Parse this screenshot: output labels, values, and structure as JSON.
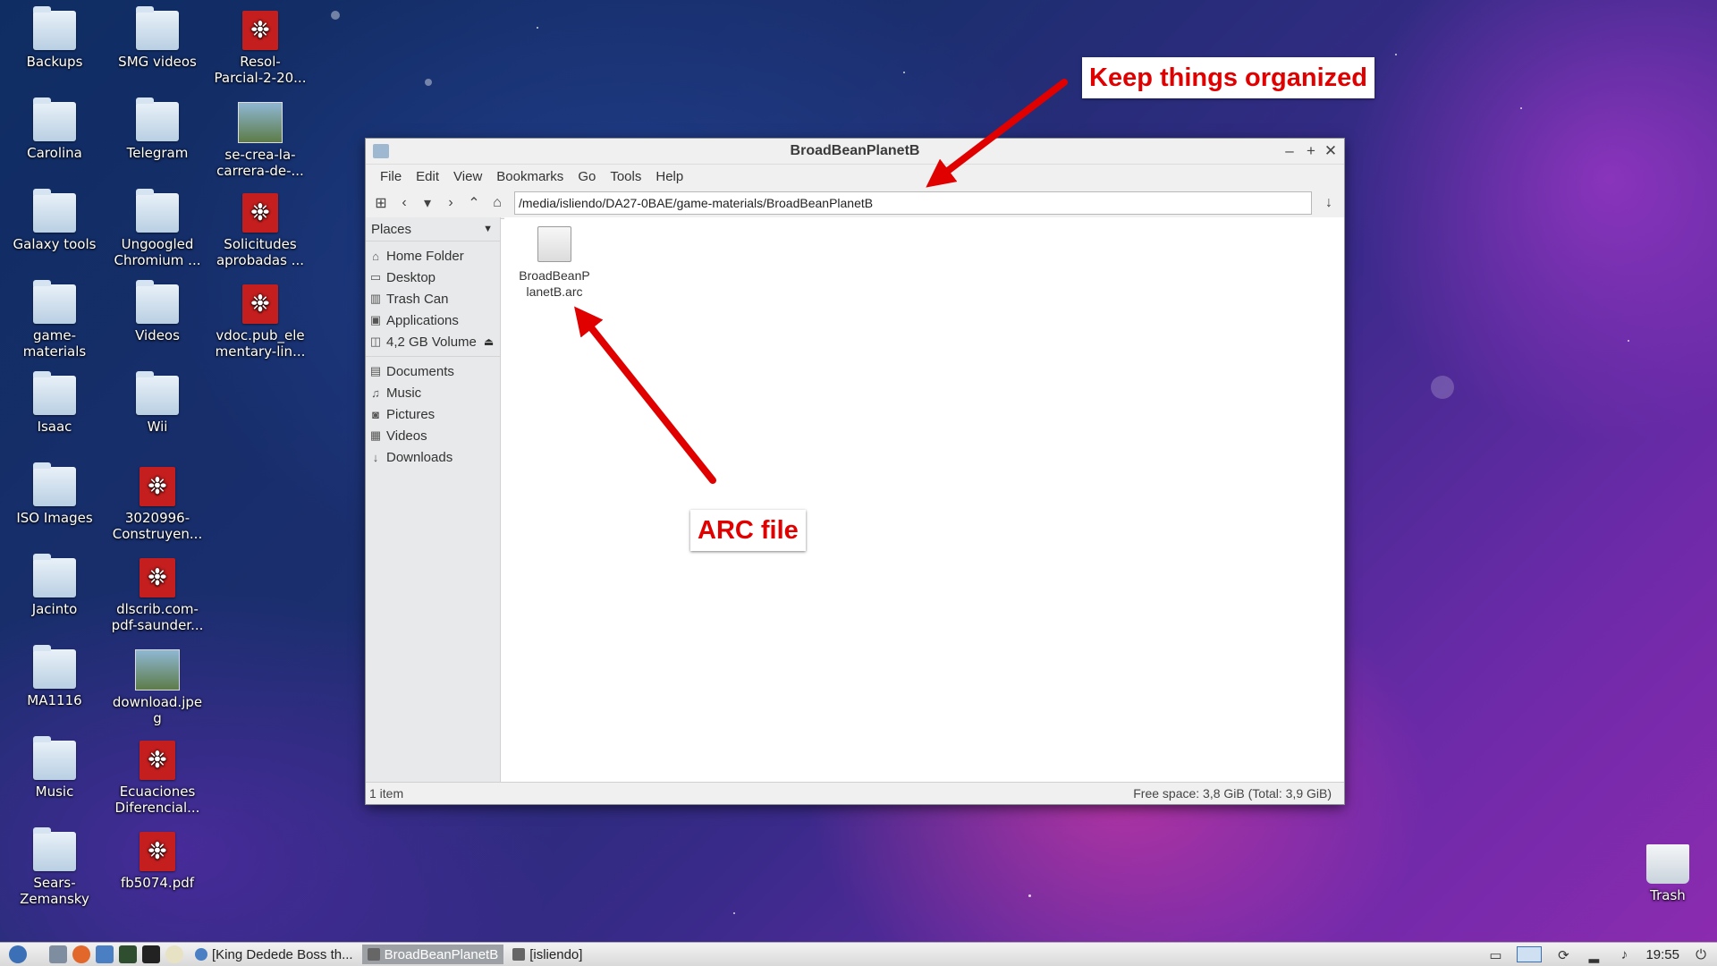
{
  "desktop": {
    "icons": [
      {
        "label": "Backups",
        "kind": "folder"
      },
      {
        "label": "Carolina",
        "kind": "folder"
      },
      {
        "label": "Galaxy tools",
        "kind": "folder"
      },
      {
        "label": "game-\nmaterials",
        "kind": "folder"
      },
      {
        "label": "Isaac",
        "kind": "folder"
      },
      {
        "label": "ISO Images",
        "kind": "folder"
      },
      {
        "label": "Jacinto",
        "kind": "folder"
      },
      {
        "label": "MA1116",
        "kind": "folder"
      },
      {
        "label": "Music",
        "kind": "folder"
      },
      {
        "label": "Sears-\nZemansky",
        "kind": "folder"
      },
      {
        "label": "SMG videos",
        "kind": "folder"
      },
      {
        "label": "Telegram",
        "kind": "folder"
      },
      {
        "label": "Ungoogled\nChromium ...",
        "kind": "folder"
      },
      {
        "label": "Videos",
        "kind": "folder"
      },
      {
        "label": "Wii",
        "kind": "folder"
      },
      {
        "label": "3020996-\nConstruyen...",
        "kind": "pdf"
      },
      {
        "label": "dlscrib.com-\npdf-saunder...",
        "kind": "pdf"
      },
      {
        "label": "download.jpe\ng",
        "kind": "image"
      },
      {
        "label": "Ecuaciones\nDiferencial...",
        "kind": "pdf"
      },
      {
        "label": "fb5074.pdf",
        "kind": "pdf"
      },
      {
        "label": "Resol-\nParcial-2-20...",
        "kind": "pdf"
      },
      {
        "label": "se-crea-la-\ncarrera-de-...",
        "kind": "image"
      },
      {
        "label": "Solicitudes\naprobadas ...",
        "kind": "pdf"
      },
      {
        "label": "vdoc.pub_ele\nmentary-lin...",
        "kind": "pdf"
      }
    ],
    "trash_label": "Trash"
  },
  "window": {
    "title": "BroadBeanPlanetB",
    "menu": [
      "File",
      "Edit",
      "View",
      "Bookmarks",
      "Go",
      "Tools",
      "Help"
    ],
    "path": "/media/isliendo/DA27-0BAE/game-materials/BroadBeanPlanetB",
    "places_label": "Places",
    "places": [
      {
        "label": "Home Folder",
        "icon": "home-icon"
      },
      {
        "label": "Desktop",
        "icon": "desktop-icon"
      },
      {
        "label": "Trash Can",
        "icon": "trash-icon"
      },
      {
        "label": "Applications",
        "icon": "applications-icon"
      },
      {
        "label": "4,2 GB Volume",
        "icon": "drive-icon"
      }
    ],
    "bookmarks": [
      {
        "label": "Documents",
        "icon": "documents-icon"
      },
      {
        "label": "Music",
        "icon": "music-icon"
      },
      {
        "label": "Pictures",
        "icon": "pictures-icon"
      },
      {
        "label": "Videos",
        "icon": "videos-icon"
      },
      {
        "label": "Downloads",
        "icon": "downloads-icon"
      }
    ],
    "file": {
      "name": "BroadBeanP\nlanetB.arc"
    },
    "status_left": "1 item",
    "status_right": "Free space: 3,8 GiB (Total: 3,9 GiB)"
  },
  "annotations": {
    "top": "Keep things organized",
    "file": "ARC file",
    "color": "#e00000"
  },
  "taskbar": {
    "tasks": [
      {
        "label": "[King Dedede Boss th...",
        "active": false
      },
      {
        "label": "BroadBeanPlanetB",
        "active": true
      },
      {
        "label": "[isliendo]",
        "active": false
      }
    ],
    "clock": "19:55"
  }
}
